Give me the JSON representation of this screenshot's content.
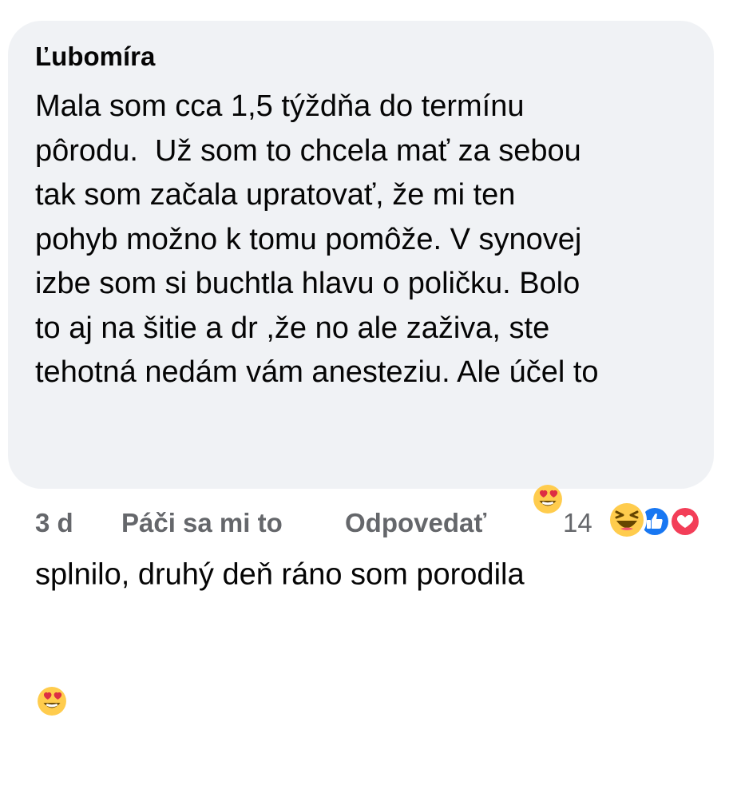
{
  "comment": {
    "author": "Ľubomíra",
    "lines": [
      "Mala som cca 1,5 týždňa do termínu",
      "pôrodu.  Už som to chcela mať za sebou",
      "tak som začala upratovať, že mi ten",
      "pohyb možno k tomu pomôže. V synovej",
      "izbe som si buchtla hlavu o poličku. Bolo",
      "to aj na šitie a dr ,že no ale zaživa, ste",
      "tehotná nedám vám anesteziu. Ale účel to",
      "splnilo, druhý deň ráno som porodila "
    ],
    "emojis": [
      "heart-eyes-emoji",
      "heart-eyes-emoji"
    ]
  },
  "footer": {
    "time": "3 d",
    "like_label": "Páči sa mi to",
    "reply_label": "Odpovedať",
    "reaction_count": "14",
    "reactions": [
      "haha-reaction-icon",
      "like-reaction-icon",
      "love-reaction-icon"
    ]
  },
  "colors": {
    "bubble_bg": "#f0f2f5",
    "text": "#050505",
    "secondary_text": "#65676b",
    "like_blue": "#1877f2",
    "love_red": "#f33e58",
    "emoji_yellow": "#ffcc4d"
  }
}
